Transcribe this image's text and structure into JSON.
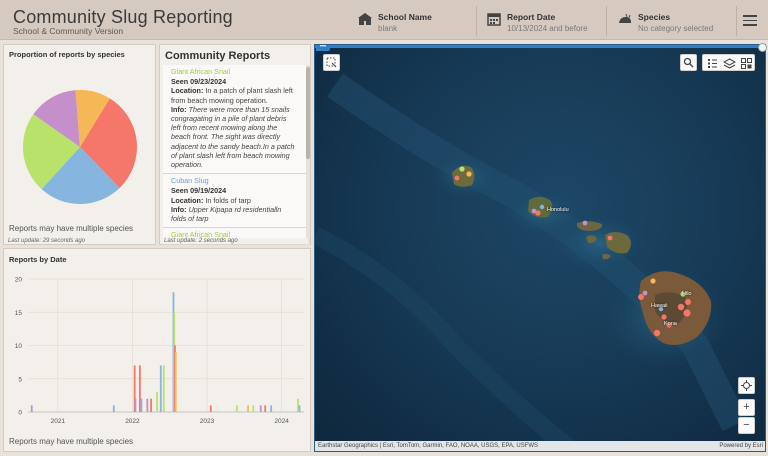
{
  "header": {
    "title": "Community Slug Reporting",
    "subtitle": "School & Community Version",
    "filters": [
      {
        "label": "School Name",
        "value": "blank",
        "icon": "school-icon"
      },
      {
        "label": "Report Date",
        "value": "10/13/2024 and before",
        "icon": "calendar-icon"
      },
      {
        "label": "Species",
        "value": "No category selected",
        "icon": "slug-icon"
      }
    ]
  },
  "pie_panel": {
    "title": "Proportion of reports by species",
    "note": "Reports may have multiple species",
    "updated": "Last update: 29 seconds ago"
  },
  "reports_panel": {
    "title": "Community Reports",
    "updated": "Last update: 2 seconds ago",
    "items": [
      {
        "species": "Giant African Snail",
        "species_color": "#9ccc3c",
        "seen": "Seen 09/23/2024",
        "location_label": "Location:",
        "location": "In a patch of plant slash left from beach mowing operation.",
        "info_label": "Info:",
        "info": "There were more than 15 snails congragating in a pile of plant debris left from recent mowing along the beach front. The sight was directly adjacent to the sandy beach.In a patch of plant slash left from beach mowing operation."
      },
      {
        "species": "Cuban Slug",
        "species_color": "#6aa0d8",
        "seen": "Seen 09/19/2024",
        "location_label": "Location:",
        "location": "In folds of tarp",
        "info_label": "Info:",
        "info": "Upper Kipapa rd residentialln folds of tarp"
      },
      {
        "species": "Giant African Snail",
        "species_color": "#9ccc3c",
        "seen": "",
        "location_label": "",
        "location": "",
        "info_label": "",
        "info": ""
      }
    ]
  },
  "date_panel": {
    "title": "Reports by Date",
    "note": "Reports may have multiple species"
  },
  "map": {
    "attribution": "Earthstar Geographics | Esri, TomTom, Garmin, FAO, NOAA, USGS, EPA, USFWS",
    "powered_by": "Powered by Esri",
    "places": [
      "Honolulu",
      "Hilo",
      "Hawaii",
      "Kona"
    ],
    "zoom_in": "+",
    "zoom_out": "−"
  },
  "chart_data": [
    {
      "type": "pie",
      "title": "Proportion of reports by species",
      "series": [
        {
          "value": 0.29,
          "color": "#f4776a"
        },
        {
          "value": 0.24,
          "color": "#86b6e0"
        },
        {
          "value": 0.23,
          "color": "#b8e26a"
        },
        {
          "value": 0.14,
          "color": "#c48fcb"
        },
        {
          "value": 0.1,
          "color": "#f6b857"
        }
      ]
    },
    {
      "type": "bar",
      "title": "Reports by Date",
      "ylim": [
        0,
        20
      ],
      "yticks": [
        0,
        5,
        10,
        15,
        20
      ],
      "xticks": [
        "2021",
        "2022",
        "2023",
        "2024"
      ],
      "xrange": [
        2020.6,
        2024.3
      ],
      "grid": true,
      "bars": [
        {
          "x": 2020.65,
          "y": 1,
          "color": "#c48fcb"
        },
        {
          "x": 2021.75,
          "y": 1,
          "color": "#86b6e0"
        },
        {
          "x": 2022.03,
          "y": 7,
          "color": "#f4776a"
        },
        {
          "x": 2022.04,
          "y": 2,
          "color": "#c48fcb"
        },
        {
          "x": 2022.1,
          "y": 7,
          "color": "#f4776a"
        },
        {
          "x": 2022.12,
          "y": 2,
          "color": "#86b6e0"
        },
        {
          "x": 2022.2,
          "y": 2,
          "color": "#c48fcb"
        },
        {
          "x": 2022.25,
          "y": 2,
          "color": "#f4776a"
        },
        {
          "x": 2022.33,
          "y": 3,
          "color": "#b8e26a"
        },
        {
          "x": 2022.38,
          "y": 7,
          "color": "#86b6e0"
        },
        {
          "x": 2022.42,
          "y": 7,
          "color": "#b8e26a"
        },
        {
          "x": 2022.55,
          "y": 18,
          "color": "#86b6e0"
        },
        {
          "x": 2022.56,
          "y": 15,
          "color": "#b8e26a"
        },
        {
          "x": 2022.57,
          "y": 10,
          "color": "#f4776a"
        },
        {
          "x": 2022.58,
          "y": 9,
          "color": "#f6b857"
        },
        {
          "x": 2023.05,
          "y": 1,
          "color": "#f4776a"
        },
        {
          "x": 2023.4,
          "y": 1,
          "color": "#b8e26a"
        },
        {
          "x": 2023.55,
          "y": 1,
          "color": "#f6b857"
        },
        {
          "x": 2023.62,
          "y": 1,
          "color": "#b8e26a"
        },
        {
          "x": 2023.72,
          "y": 1,
          "color": "#c48fcb"
        },
        {
          "x": 2023.78,
          "y": 1,
          "color": "#f4776a"
        },
        {
          "x": 2023.86,
          "y": 1,
          "color": "#86b6e0"
        },
        {
          "x": 2024.22,
          "y": 2,
          "color": "#b8e26a"
        },
        {
          "x": 2024.24,
          "y": 1,
          "color": "#86b6e0"
        }
      ],
      "note": "Reports may have multiple species"
    }
  ]
}
